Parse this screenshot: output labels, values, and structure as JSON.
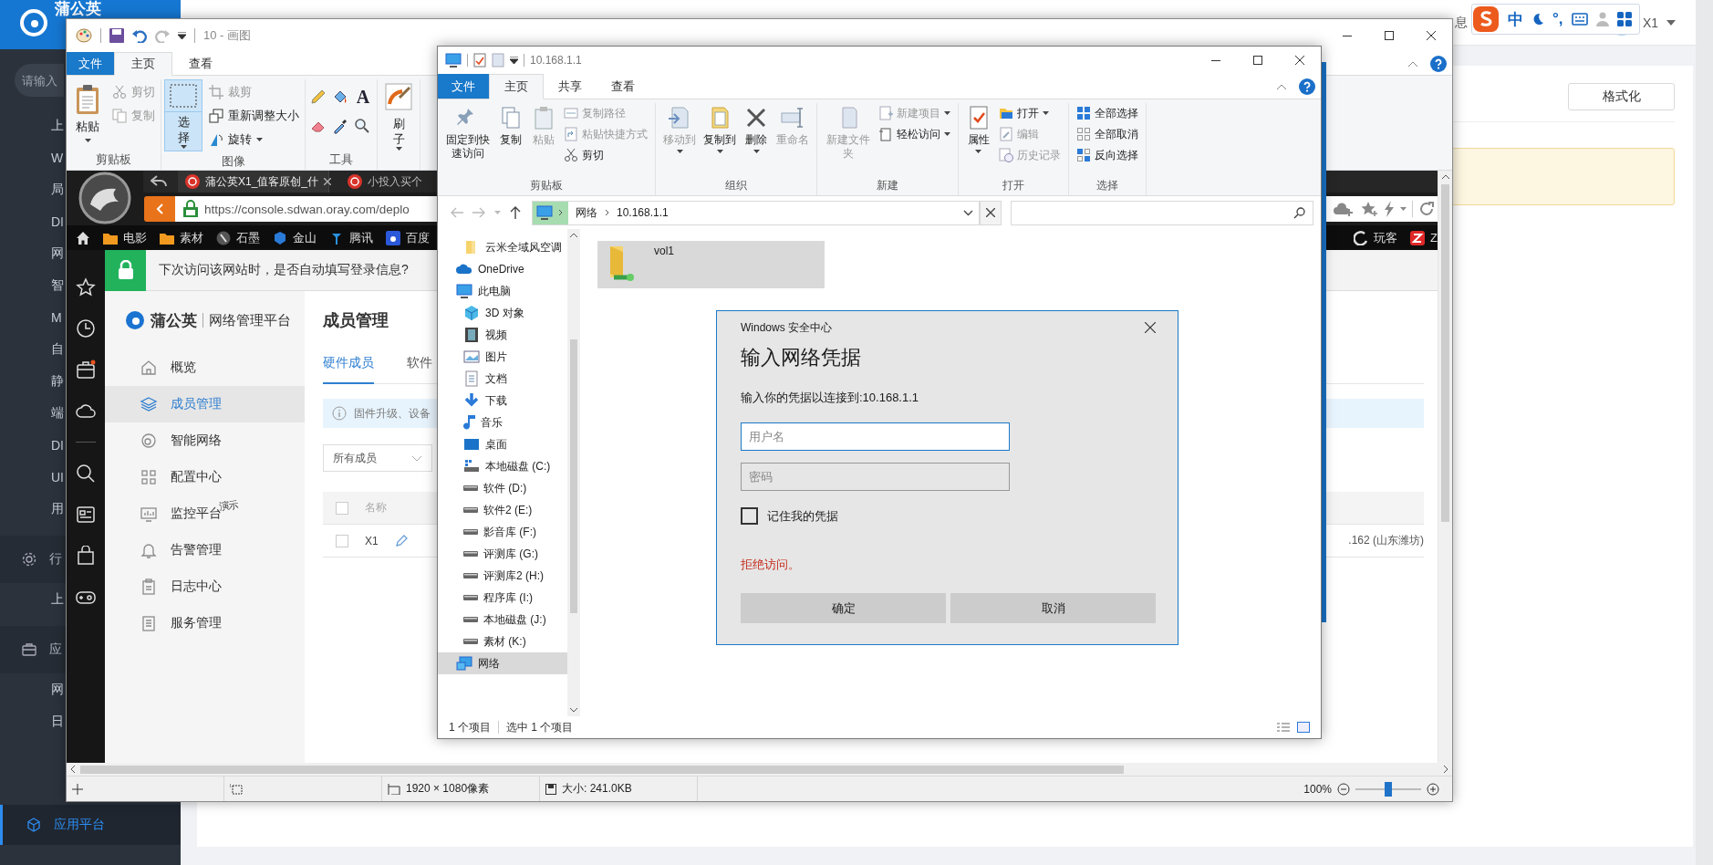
{
  "desktop_app": {
    "logo": "蒲公英",
    "search_placeholder": "请输入",
    "sidebar": [
      {
        "label": "上",
        "kind": "item",
        "selected": false
      },
      {
        "label": "W",
        "kind": "item",
        "selected": false
      },
      {
        "label": "局",
        "kind": "item",
        "selected": false
      },
      {
        "label": "DI",
        "kind": "item",
        "selected": false
      },
      {
        "label": "网",
        "kind": "item",
        "selected": false
      },
      {
        "label": "智",
        "kind": "item",
        "selected": false
      },
      {
        "label": "M",
        "kind": "item",
        "selected": false
      },
      {
        "label": "自",
        "kind": "item",
        "selected": false
      },
      {
        "label": "静",
        "kind": "item",
        "selected": false
      },
      {
        "label": "端",
        "kind": "item",
        "selected": false
      },
      {
        "label": "DI",
        "kind": "item",
        "selected": false
      },
      {
        "label": "UI",
        "kind": "item",
        "selected": false
      },
      {
        "label": "用",
        "kind": "item",
        "selected": false
      },
      {
        "label": "行",
        "kind": "section",
        "selected": false
      },
      {
        "label": "上",
        "kind": "item",
        "selected": false
      },
      {
        "label": "应",
        "kind": "section",
        "selected": false
      },
      {
        "label": "网",
        "kind": "item",
        "selected": false
      },
      {
        "label": "日",
        "kind": "item",
        "selected": false
      },
      {
        "label": "应用平台",
        "kind": "section",
        "selected": true
      }
    ],
    "messages": "息",
    "user": "X1",
    "format_button": "格式化"
  },
  "ime_toolbar": {
    "language": "中",
    "punctuation": "°,"
  },
  "paint": {
    "title": "10 - 画图",
    "tabs": [
      {
        "label": "文件",
        "kind": "menu",
        "selected": false
      },
      {
        "label": "主页",
        "kind": "tab",
        "selected": true
      },
      {
        "label": "查看",
        "kind": "tab",
        "selected": false
      }
    ],
    "ribbon": [
      {
        "label": "剪贴板",
        "kind": "buttons",
        "items": [
          {
            "label": "粘贴",
            "kind": "large",
            "dropdown": true,
            "active": false,
            "disabled": false
          },
          {
            "label": "剪切",
            "kind": "small",
            "dropdown": false,
            "active": false,
            "disabled": true
          },
          {
            "label": "复制",
            "kind": "small",
            "dropdown": false,
            "active": false,
            "disabled": true
          }
        ]
      },
      {
        "label": "图像",
        "kind": "buttons",
        "items": [
          {
            "label": "选择",
            "kind": "split",
            "dropdown": true,
            "active": true,
            "disabled": false
          },
          {
            "label": "裁剪",
            "kind": "small",
            "dropdown": false,
            "active": false,
            "disabled": true
          },
          {
            "label": "重新调整大小",
            "kind": "small",
            "dropdown": false,
            "active": false,
            "disabled": false
          },
          {
            "label": "旋转",
            "kind": "small",
            "dropdown": true,
            "active": false,
            "disabled": false
          }
        ]
      },
      {
        "label": "工具",
        "kind": "tools",
        "text_tool": "A"
      },
      {
        "kind": "buttons",
        "items": [
          {
            "label": "刷子",
            "kind": "split",
            "dropdown": true,
            "active": false,
            "disabled": false
          }
        ]
      }
    ],
    "canvas_size": "1920 × 1080像素",
    "file_size": "大小: 241.0KB",
    "zoom": "100%",
    "zoom_slider": {
      "level": 0.5
    }
  },
  "browser_screenshot": {
    "tabs": [
      {
        "title": "蒲公英X1_值客原创_什",
        "selected": true
      },
      {
        "title": "小投入买个",
        "selected": false
      }
    ],
    "url": "https://console.sdwan.oray.com/deplo",
    "bookmarks": [
      {
        "label": "电影",
        "kind": "folder"
      },
      {
        "label": "素材",
        "kind": "folder"
      },
      {
        "label": "石墨",
        "kind": "site"
      },
      {
        "label": "金山",
        "kind": "site"
      },
      {
        "label": "腾讯",
        "kind": "site"
      },
      {
        "label": "百度",
        "kind": "site"
      }
    ],
    "bookmarks_right": [
      {
        "label": "玩客"
      },
      {
        "label": "Z"
      }
    ],
    "infobar": "下次访问该网站时，是否自动填写登录信息?",
    "app": {
      "brand": "蒲公英",
      "product": "网络管理平台",
      "nav": [
        {
          "label": "概览",
          "selected": false
        },
        {
          "label": "成员管理",
          "selected": true
        },
        {
          "label": "智能网络",
          "selected": false
        },
        {
          "label": "配置中心",
          "selected": false
        },
        {
          "label": "监控平台",
          "badge": "演示",
          "selected": false
        },
        {
          "label": "告警管理",
          "selected": false
        },
        {
          "label": "日志中心",
          "selected": false
        },
        {
          "label": "服务管理",
          "selected": false
        }
      ],
      "page_title": "成员管理",
      "tabs": [
        {
          "label": "硬件成员",
          "selected": true
        },
        {
          "label": "软件",
          "selected": false
        }
      ],
      "notice": "固件升级、设备",
      "filter": "所有成员",
      "columns": [
        "名称"
      ],
      "select_all": {
        "checked": false
      },
      "rows": [
        {
          "name": "X1",
          "address": ".162 (山东潍坊)",
          "checked": false
        }
      ]
    }
  },
  "explorer": {
    "title": "10.168.1.1",
    "tabs": [
      {
        "label": "文件",
        "kind": "menu",
        "selected": false
      },
      {
        "label": "主页",
        "kind": "tab",
        "selected": true
      },
      {
        "label": "共享",
        "kind": "tab",
        "selected": false
      },
      {
        "label": "查看",
        "kind": "tab",
        "selected": false
      }
    ],
    "ribbon": [
      {
        "label": "剪贴板",
        "items": [
          {
            "label": "固定到快速访问",
            "kind": "large",
            "dropdown": false,
            "disabled": false
          },
          {
            "label": "复制",
            "kind": "large",
            "dropdown": false,
            "disabled": false
          },
          {
            "label": "粘贴",
            "kind": "large",
            "dropdown": false,
            "disabled": true
          },
          {
            "label": "复制路径",
            "kind": "small",
            "dropdown": false,
            "disabled": true
          },
          {
            "label": "粘贴快捷方式",
            "kind": "small",
            "dropdown": false,
            "disabled": true
          },
          {
            "label": "剪切",
            "kind": "small",
            "dropdown": false,
            "disabled": false
          }
        ]
      },
      {
        "label": "组织",
        "items": [
          {
            "label": "移动到",
            "kind": "large",
            "dropdown": true,
            "disabled": true
          },
          {
            "label": "复制到",
            "kind": "large",
            "dropdown": true,
            "disabled": false
          },
          {
            "label": "删除",
            "kind": "large",
            "dropdown": true,
            "disabled": false
          },
          {
            "label": "重命名",
            "kind": "large",
            "dropdown": false,
            "disabled": true
          }
        ]
      },
      {
        "label": "新建",
        "items": [
          {
            "label": "新建文件夹",
            "kind": "large",
            "dropdown": false,
            "disabled": true
          },
          {
            "label": "新建项目",
            "kind": "small",
            "dropdown": true,
            "disabled": true
          },
          {
            "label": "轻松访问",
            "kind": "small",
            "dropdown": true,
            "disabled": false
          }
        ]
      },
      {
        "label": "打开",
        "items": [
          {
            "label": "属性",
            "kind": "large",
            "dropdown": true,
            "disabled": false
          },
          {
            "label": "打开",
            "kind": "small",
            "dropdown": true,
            "disabled": false
          },
          {
            "label": "编辑",
            "kind": "small",
            "dropdown": false,
            "disabled": true
          },
          {
            "label": "历史记录",
            "kind": "small",
            "dropdown": false,
            "disabled": true
          }
        ]
      },
      {
        "label": "选择",
        "items": [
          {
            "label": "全部选择",
            "kind": "small",
            "dropdown": false,
            "disabled": false
          },
          {
            "label": "全部取消",
            "kind": "small",
            "dropdown": false,
            "disabled": false
          },
          {
            "label": "反向选择",
            "kind": "small",
            "dropdown": false,
            "disabled": false
          }
        ]
      }
    ],
    "address": [
      "网络",
      "10.168.1.1"
    ],
    "nav": [
      {
        "label": "云米全域风空调",
        "kind": "folder",
        "selected": false
      },
      {
        "label": "OneDrive",
        "kind": "cloud",
        "selected": false
      },
      {
        "label": "此电脑",
        "kind": "pc",
        "selected": false,
        "children": [
          {
            "label": "3D 对象",
            "kind": "objects",
            "selected": false
          },
          {
            "label": "视频",
            "kind": "video",
            "selected": false
          },
          {
            "label": "图片",
            "kind": "pictures",
            "selected": false
          },
          {
            "label": "文档",
            "kind": "documents",
            "selected": false
          },
          {
            "label": "下载",
            "kind": "downloads",
            "selected": false
          },
          {
            "label": "音乐",
            "kind": "music",
            "selected": false
          },
          {
            "label": "桌面",
            "kind": "desktop",
            "selected": false
          },
          {
            "label": "本地磁盘 (C:)",
            "kind": "system-drive",
            "selected": false
          },
          {
            "label": "软件 (D:)",
            "kind": "drive",
            "selected": false
          },
          {
            "label": "软件2 (E:)",
            "kind": "drive",
            "selected": false
          },
          {
            "label": "影音库 (F:)",
            "kind": "drive",
            "selected": false
          },
          {
            "label": "评测库 (G:)",
            "kind": "drive",
            "selected": false
          },
          {
            "label": "评测库2 (H:)",
            "kind": "drive",
            "selected": false
          },
          {
            "label": "程序库 (I:)",
            "kind": "drive",
            "selected": false
          },
          {
            "label": "本地磁盘 (J:)",
            "kind": "drive",
            "selected": false
          },
          {
            "label": "素材 (K:)",
            "kind": "drive",
            "selected": false
          }
        ]
      },
      {
        "label": "网络",
        "kind": "network",
        "selected": true
      }
    ],
    "files": [
      {
        "name": "vol1",
        "selected": true
      }
    ],
    "item_count": "1 个项目",
    "selection_count": "选中 1 个项目"
  },
  "dialog": {
    "app": "Windows 安全中心",
    "title": "输入网络凭据",
    "prompt": "输入你的凭据以连接到:10.168.1.1",
    "username": {
      "placeholder": "用户名",
      "focused": true
    },
    "password": {
      "placeholder": "密码",
      "focused": false
    },
    "remember": {
      "label": "记住我的凭据",
      "checked": false
    },
    "error": "拒绝访问。",
    "buttons": [
      "确定",
      "取消"
    ]
  }
}
